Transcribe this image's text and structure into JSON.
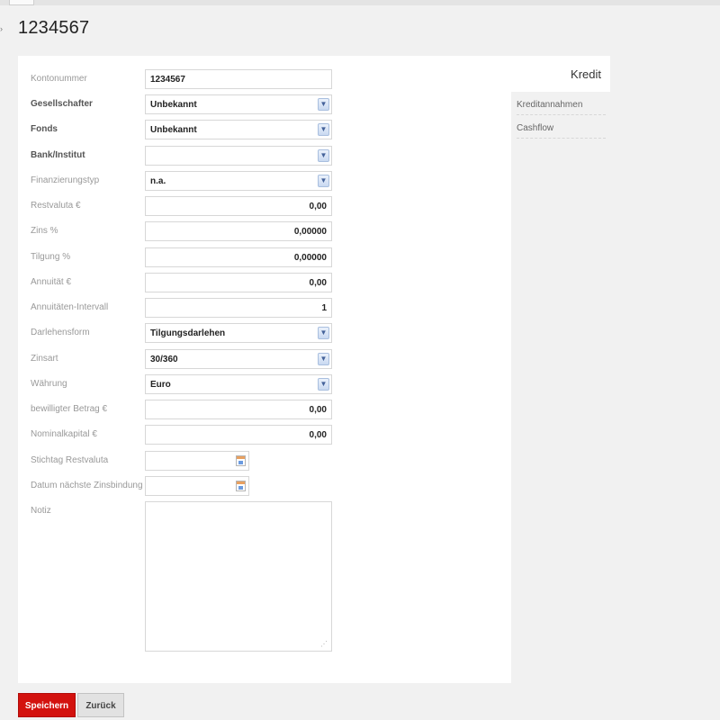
{
  "page": {
    "title": "1234567"
  },
  "form": {
    "fields": [
      {
        "label": "Kontonummer",
        "value": "1234567",
        "kind": "text",
        "bold": false
      },
      {
        "label": "Gesellschafter",
        "value": "Unbekannt",
        "kind": "select",
        "bold": true
      },
      {
        "label": "Fonds",
        "value": "Unbekannt",
        "kind": "select",
        "bold": true
      },
      {
        "label": "Bank/Institut",
        "value": "",
        "kind": "select",
        "bold": true
      },
      {
        "label": "Finanzierungstyp",
        "value": "n.a.",
        "kind": "select",
        "bold": false
      },
      {
        "label": "Restvaluta €",
        "value": "0,00",
        "kind": "number",
        "bold": false
      },
      {
        "label": "Zins %",
        "value": "0,00000",
        "kind": "number",
        "bold": false
      },
      {
        "label": "Tilgung %",
        "value": "0,00000",
        "kind": "number",
        "bold": false
      },
      {
        "label": "Annuität €",
        "value": "0,00",
        "kind": "number",
        "bold": false
      },
      {
        "label": "Annuitäten-Intervall",
        "value": "1",
        "kind": "number",
        "bold": false
      },
      {
        "label": "Darlehensform",
        "value": "Tilgungsdarlehen",
        "kind": "select",
        "bold": false
      },
      {
        "label": "Zinsart",
        "value": "30/360",
        "kind": "select",
        "bold": false
      },
      {
        "label": "Währung",
        "value": "Euro",
        "kind": "select",
        "bold": false
      },
      {
        "label": "bewilligter Betrag €",
        "value": "0,00",
        "kind": "number",
        "bold": false
      },
      {
        "label": "Nominalkapital €",
        "value": "0,00",
        "kind": "number",
        "bold": false
      },
      {
        "label": "Stichtag Restvaluta",
        "value": "",
        "kind": "date",
        "bold": false
      },
      {
        "label": "Datum nächste Zinsbindung",
        "value": "",
        "kind": "date",
        "bold": false
      }
    ],
    "notiz_label": "Notiz",
    "notiz_value": ""
  },
  "tabs": {
    "active": "Kredit"
  },
  "side_menu": {
    "items": [
      "Kreditannahmen",
      "Cashflow"
    ]
  },
  "buttons": {
    "save": "Speichern",
    "back": "Zurück"
  },
  "colors": {
    "save_button": "#d3120e",
    "panel_bg": "#ffffff",
    "page_bg": "#f1f1f1"
  },
  "icons": {
    "select_arrow": "chevron-down-icon",
    "date_picker": "calendar-icon",
    "resize": "resize-grip-icon"
  }
}
